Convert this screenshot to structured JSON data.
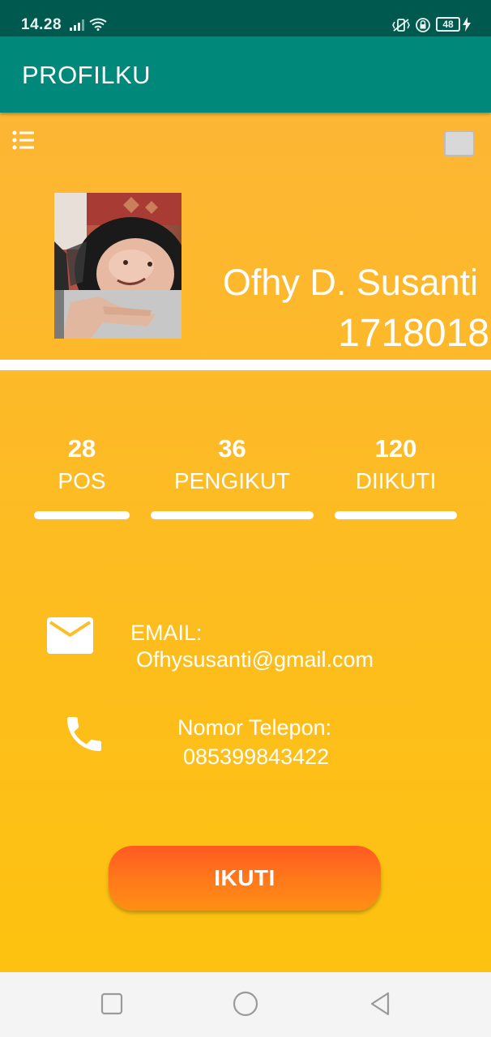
{
  "status_bar": {
    "time": "14.28",
    "battery": "48",
    "icons": [
      "signal-icon",
      "wifi-icon",
      "vibrate-icon",
      "rotation-lock-icon",
      "battery-icon",
      "charging-icon"
    ]
  },
  "app_bar": {
    "title": "PROFILKU"
  },
  "profile": {
    "name": "Ofhy D. Susanti",
    "id_number": "1718018"
  },
  "stats": [
    {
      "value": "28",
      "label": "POS"
    },
    {
      "value": "36",
      "label": "PENGIKUT"
    },
    {
      "value": "120",
      "label": "DIIKUTI"
    }
  ],
  "contact": {
    "email_label": "EMAIL:",
    "email_value": "Ofhysusanti@gmail.com",
    "phone_label": "Nomor Telepon:",
    "phone_value": "085399843422"
  },
  "follow_button": {
    "label": "IKUTI"
  },
  "colors": {
    "status_bar": "#00594f",
    "app_bar": "#00897b",
    "background": "#fdbd1e",
    "button": "#ff6a1e"
  }
}
